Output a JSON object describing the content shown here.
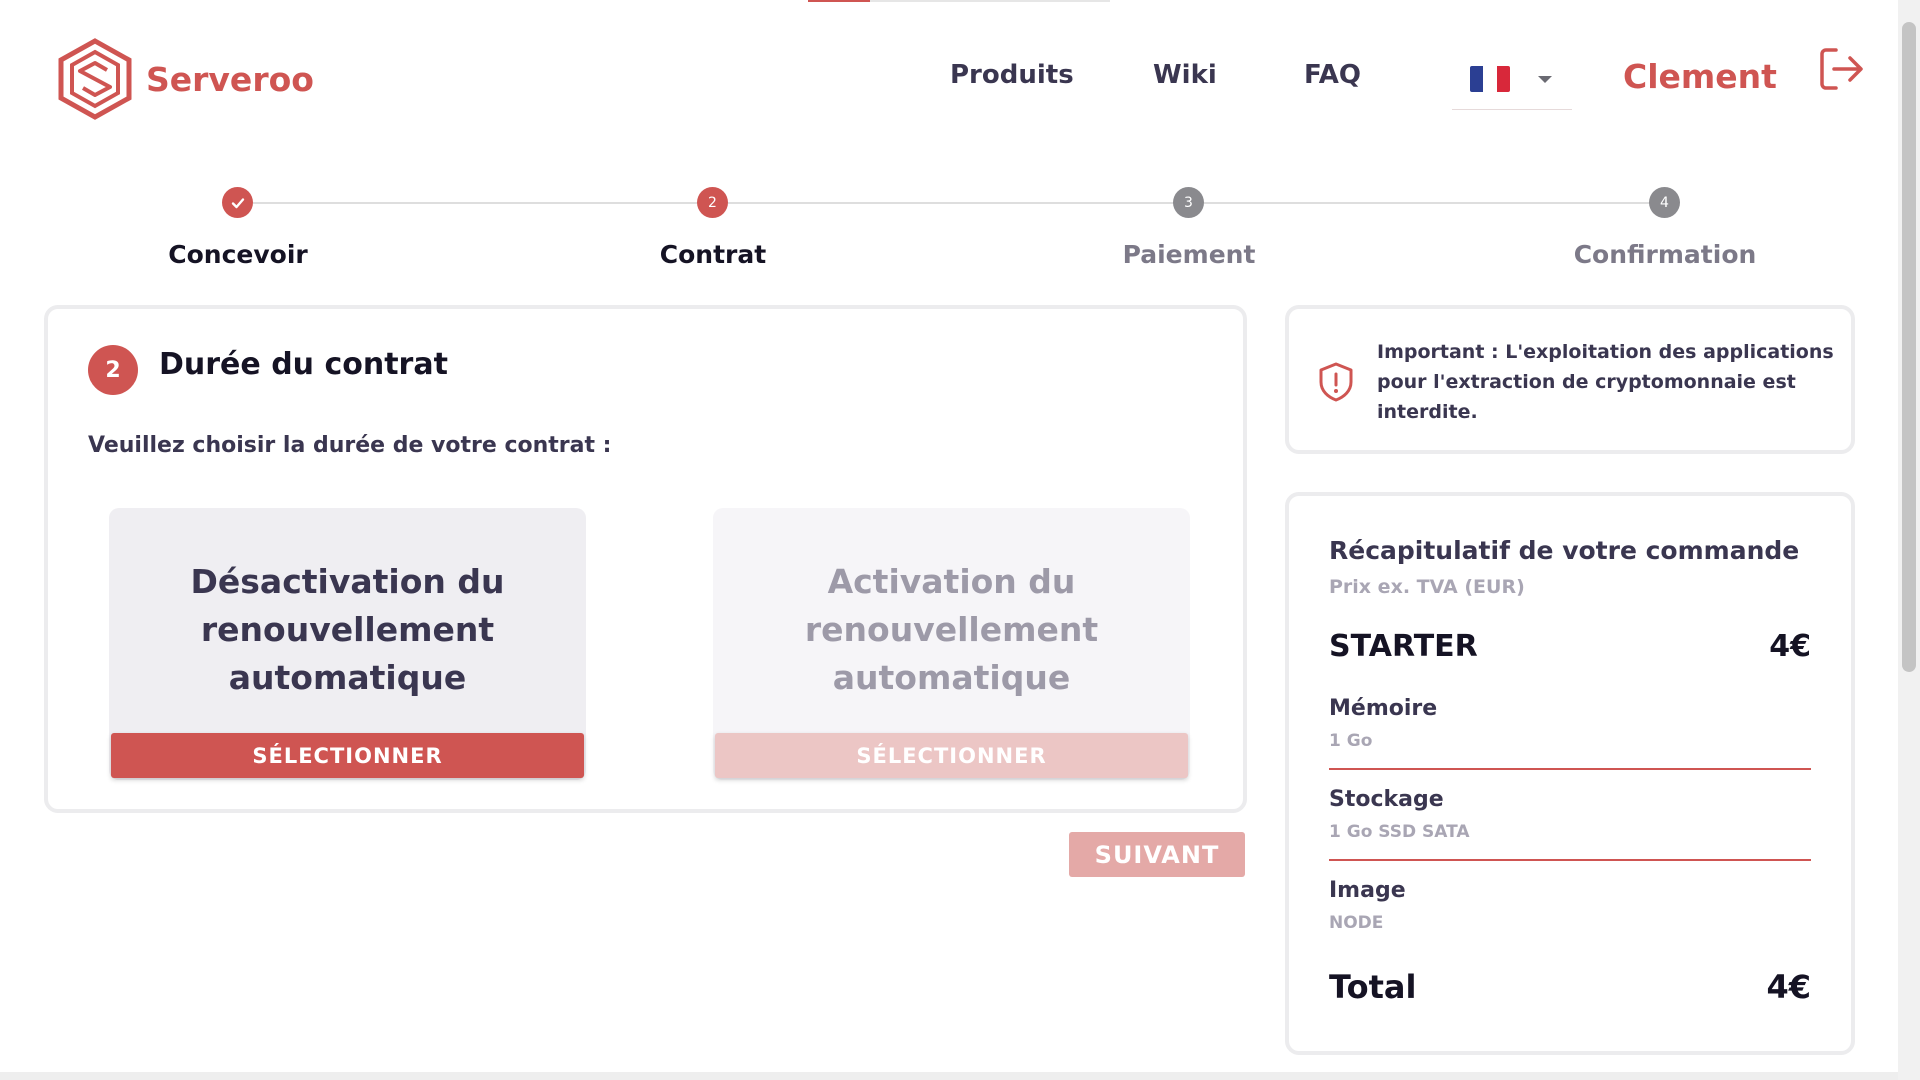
{
  "header": {
    "brand": "Serveroo",
    "nav": [
      {
        "label": "Produits"
      },
      {
        "label": "Wiki"
      },
      {
        "label": "FAQ"
      }
    ],
    "language": {
      "flag_icon": "france-flag-icon",
      "colors": [
        "#2b3f93",
        "#ffffff",
        "#d8283a"
      ]
    },
    "user": "Clement",
    "logout_icon": "logout-icon"
  },
  "stepper": {
    "steps": [
      {
        "label": "Concevoir",
        "marker": "",
        "state": "done"
      },
      {
        "label": "Contrat",
        "marker": "2",
        "state": "active"
      },
      {
        "label": "Paiement",
        "marker": "3",
        "state": "pending"
      },
      {
        "label": "Confirmation",
        "marker": "4",
        "state": "pending"
      }
    ]
  },
  "contract": {
    "number": "2",
    "title": "Durée du contrat",
    "subtitle": "Veuillez choisir la durée de votre contrat :",
    "options": [
      {
        "title": "Désactivation du renouvellement automatique",
        "button": "SÉLECTIONNER",
        "state": "selected"
      },
      {
        "title": "Activation du renouvellement automatique",
        "button": "SÉLECTIONNER",
        "state": "disabled"
      }
    ],
    "next_button": "SUIVANT"
  },
  "notice": {
    "icon": "shield-warning-icon",
    "text": "Important : L'exploitation des applications pour l'extraction de cryptomonnaie est interdite."
  },
  "summary": {
    "title": "Récapitulatif de votre commande",
    "subtitle": "Prix ex. TVA (EUR)",
    "plan": {
      "name": "STARTER",
      "price": "4€"
    },
    "details": [
      {
        "label": "Mémoire",
        "value": "1 Go"
      },
      {
        "label": "Stockage",
        "value": "1 Go SSD SATA"
      },
      {
        "label": "Image",
        "value": "NODE"
      }
    ],
    "total": {
      "label": "Total",
      "price": "4€"
    }
  },
  "colors": {
    "accent": "#cf5552",
    "accent_light": "#e4a9a7",
    "text": "#3a3650",
    "muted": "#a9a6b4"
  }
}
